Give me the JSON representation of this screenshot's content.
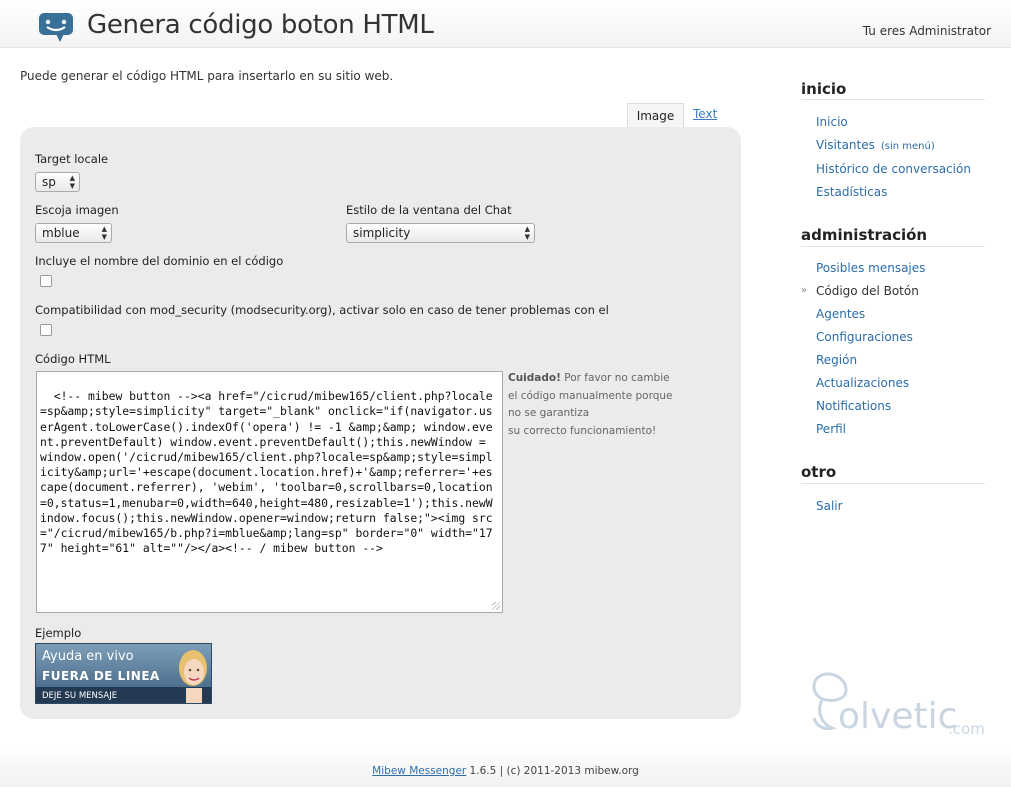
{
  "header": {
    "title": "Genera código boton HTML",
    "user_label": "Tu eres Administrator",
    "logo_icon": "chat-bubble-icon"
  },
  "intro_text": "Puede generar el código HTML para insertarlo en su sitio web.",
  "tabs": [
    {
      "label": "Image",
      "active": true
    },
    {
      "label": "Text",
      "active": false
    }
  ],
  "form": {
    "target_locale": {
      "label": "Target locale",
      "value": "sp"
    },
    "image": {
      "label": "Escoja imagen",
      "value": "mblue"
    },
    "chat_style": {
      "label": "Estilo de la ventana del Chat",
      "value": "simplicity"
    },
    "include_domain": {
      "label": "Incluye el nombre del dominio en el código",
      "checked": false
    },
    "mod_security": {
      "label": "Compatibilidad con mod_security (modsecurity.org), activar solo en caso de tener problemas con el",
      "checked": false
    },
    "code": {
      "label": "Código HTML",
      "value": "<!-- mibew button --><a href=\"/cicrud/mibew165/client.php?locale=sp&amp;style=simplicity\" target=\"_blank\" onclick=\"if(navigator.userAgent.toLowerCase().indexOf('opera') != -1 &amp;&amp; window.event.preventDefault) window.event.preventDefault();this.newWindow = window.open('/cicrud/mibew165/client.php?locale=sp&amp;style=simplicity&amp;url='+escape(document.location.href)+'&amp;referrer='+escape(document.referrer), 'webim', 'toolbar=0,scrollbars=0,location=0,status=1,menubar=0,width=640,height=480,resizable=1');this.newWindow.focus();this.newWindow.opener=window;return false;\"><img src=\"/cicrud/mibew165/b.php?i=mblue&amp;lang=sp\" border=\"0\" width=\"177\" height=\"61\" alt=\"\"/></a><!-- / mibew button -->"
    },
    "warning": {
      "bold": "Cuidado!",
      "line1": "Por favor no cambie",
      "line2": "el código manualmente porque",
      "line3": "no se garantiza",
      "line4": "su correcto funcionamiento!"
    },
    "example": {
      "label": "Ejemplo",
      "line1": "Ayuda en vivo",
      "line2": "FUERA DE LINEA",
      "line3": "DEJE SU MENSAJE"
    }
  },
  "sidebar": {
    "sections": [
      {
        "title": "inicio",
        "items": [
          {
            "label": "Inicio"
          },
          {
            "label": "Visitantes",
            "extra": "(sin menú)"
          },
          {
            "label": "Histórico de conversación"
          },
          {
            "label": "Estadísticas"
          }
        ]
      },
      {
        "title": "administración",
        "items": [
          {
            "label": "Posibles mensajes"
          },
          {
            "label": "Código del Botón",
            "current": true
          },
          {
            "label": "Agentes"
          },
          {
            "label": "Configuraciones"
          },
          {
            "label": "Región"
          },
          {
            "label": "Actualizaciones"
          },
          {
            "label": "Notifications"
          },
          {
            "label": "Perfil"
          }
        ]
      },
      {
        "title": "otro",
        "items": [
          {
            "label": "Salir"
          }
        ]
      }
    ]
  },
  "watermark": {
    "brand": "olvetic",
    "suffix": ".com"
  },
  "footer": {
    "link": "Mibew Messenger",
    "rest": " 1.6.5 | (c) 2011-2013 mibew.org"
  },
  "colors": {
    "link": "#2d6da8",
    "panel": "#ebebeb",
    "accent": "#3a6f97"
  }
}
